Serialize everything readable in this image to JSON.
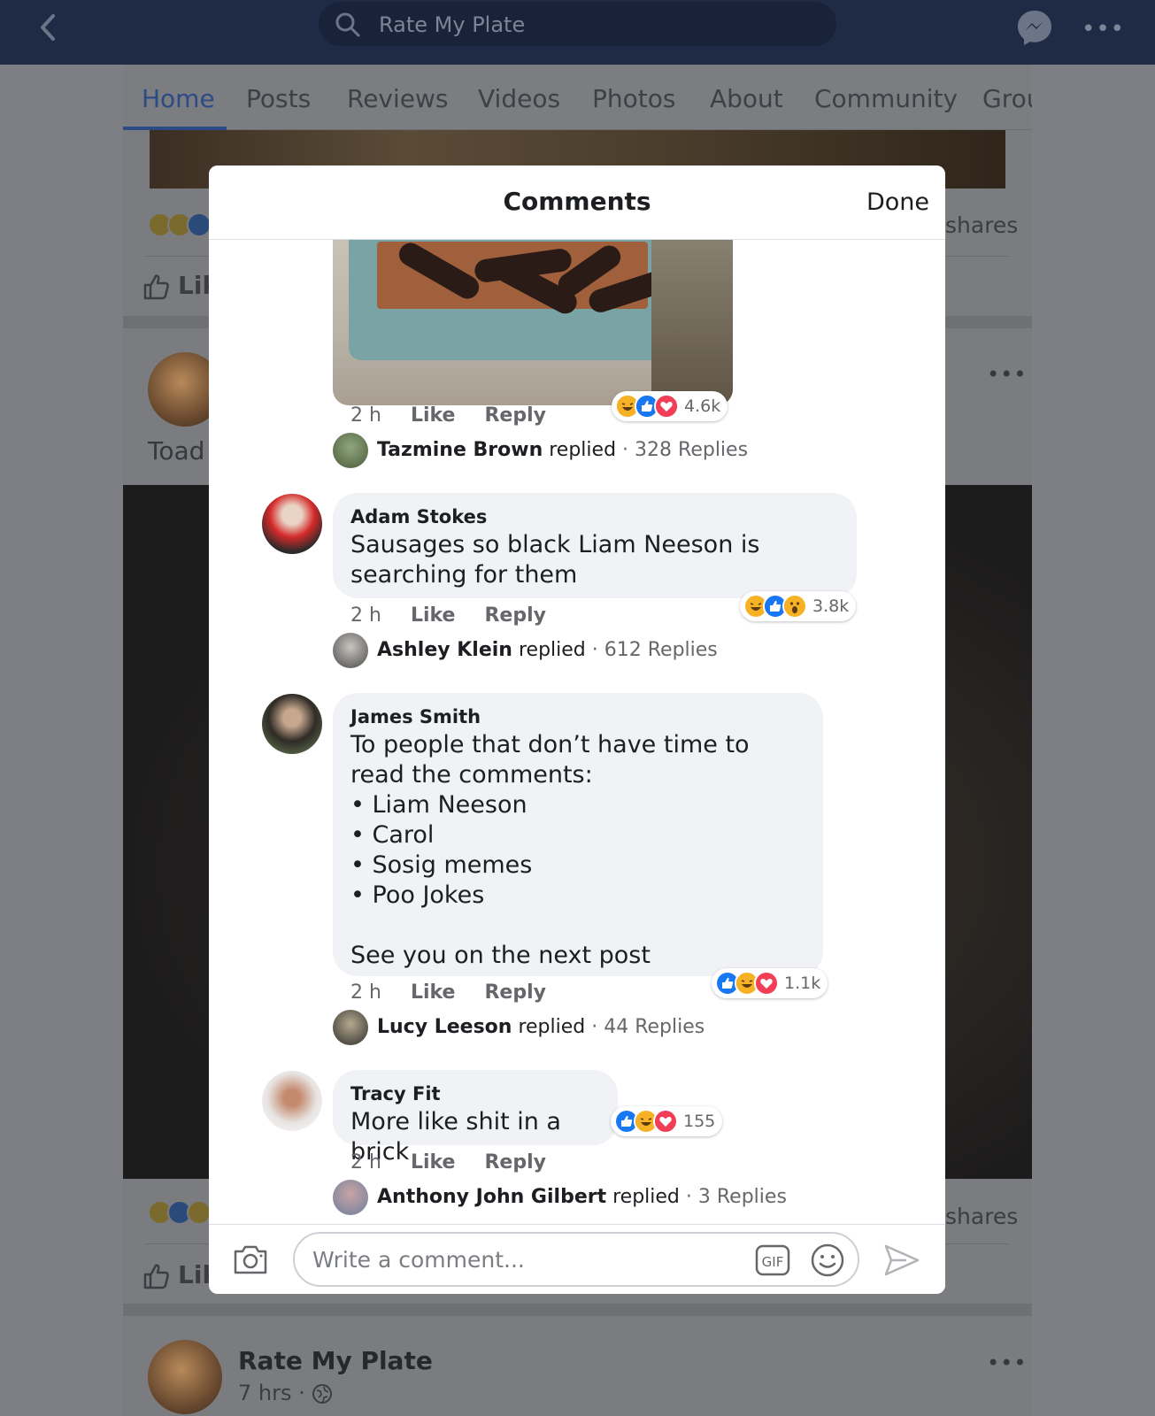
{
  "topbar": {
    "search_text": "Rate My Plate"
  },
  "tabs": [
    "Home",
    "Posts",
    "Reviews",
    "Videos",
    "Photos",
    "About",
    "Community",
    "Grou"
  ],
  "background": {
    "shares_label": "shares",
    "like_label": "Lik",
    "toad_label": "Toad",
    "post_name": "Rate My Plate",
    "post_meta": "7 hrs ·"
  },
  "modal": {
    "title": "Comments",
    "done_label": "Done",
    "input_placeholder": "Write a comment..."
  },
  "comments": [
    {
      "time": "2 h",
      "like": "Like",
      "reply": "Reply",
      "reactions": [
        "haha",
        "like",
        "love"
      ],
      "count": "4.6k",
      "replier": "Tazmine Brown",
      "replied_word": "replied",
      "replies": "· 328 Replies"
    },
    {
      "author": "Adam Stokes",
      "text": "Sausages so black Liam Neeson is searching for them",
      "time": "2 h",
      "like": "Like",
      "reply": "Reply",
      "reactions": [
        "haha",
        "like",
        "wow"
      ],
      "count": "3.8k",
      "replier": "Ashley Klein",
      "replied_word": "replied",
      "replies": "· 612 Replies"
    },
    {
      "author": "James Smith",
      "text": "To people that don’t have time to read the comments:\n• Liam Neeson\n• Carol\n• Sosig memes\n• Poo Jokes\n\nSee you on the next post",
      "time": "2 h",
      "like": "Like",
      "reply": "Reply",
      "reactions": [
        "like",
        "haha",
        "love"
      ],
      "count": "1.1k",
      "replier": "Lucy Leeson",
      "replied_word": "replied",
      "replies": "· 44 Replies"
    },
    {
      "author": "Tracy Fit",
      "text": "More like shit in a brick",
      "time": "2 h",
      "like": "Like",
      "reply": "Reply",
      "reactions": [
        "like",
        "haha",
        "love"
      ],
      "count": "155",
      "replier": "Anthony John Gilbert",
      "replied_word": "replied",
      "replies": "· 3 Replies"
    }
  ],
  "colors": {
    "like": "#1877f2",
    "love": "#f33e58",
    "haha": "#f7b125",
    "header_bg": "#1f2b45"
  },
  "icons": [
    "back-icon",
    "search-icon",
    "messenger-icon",
    "more-icon",
    "thumb-icon",
    "camera-icon",
    "gif-icon",
    "emoji-icon",
    "send-icon"
  ]
}
